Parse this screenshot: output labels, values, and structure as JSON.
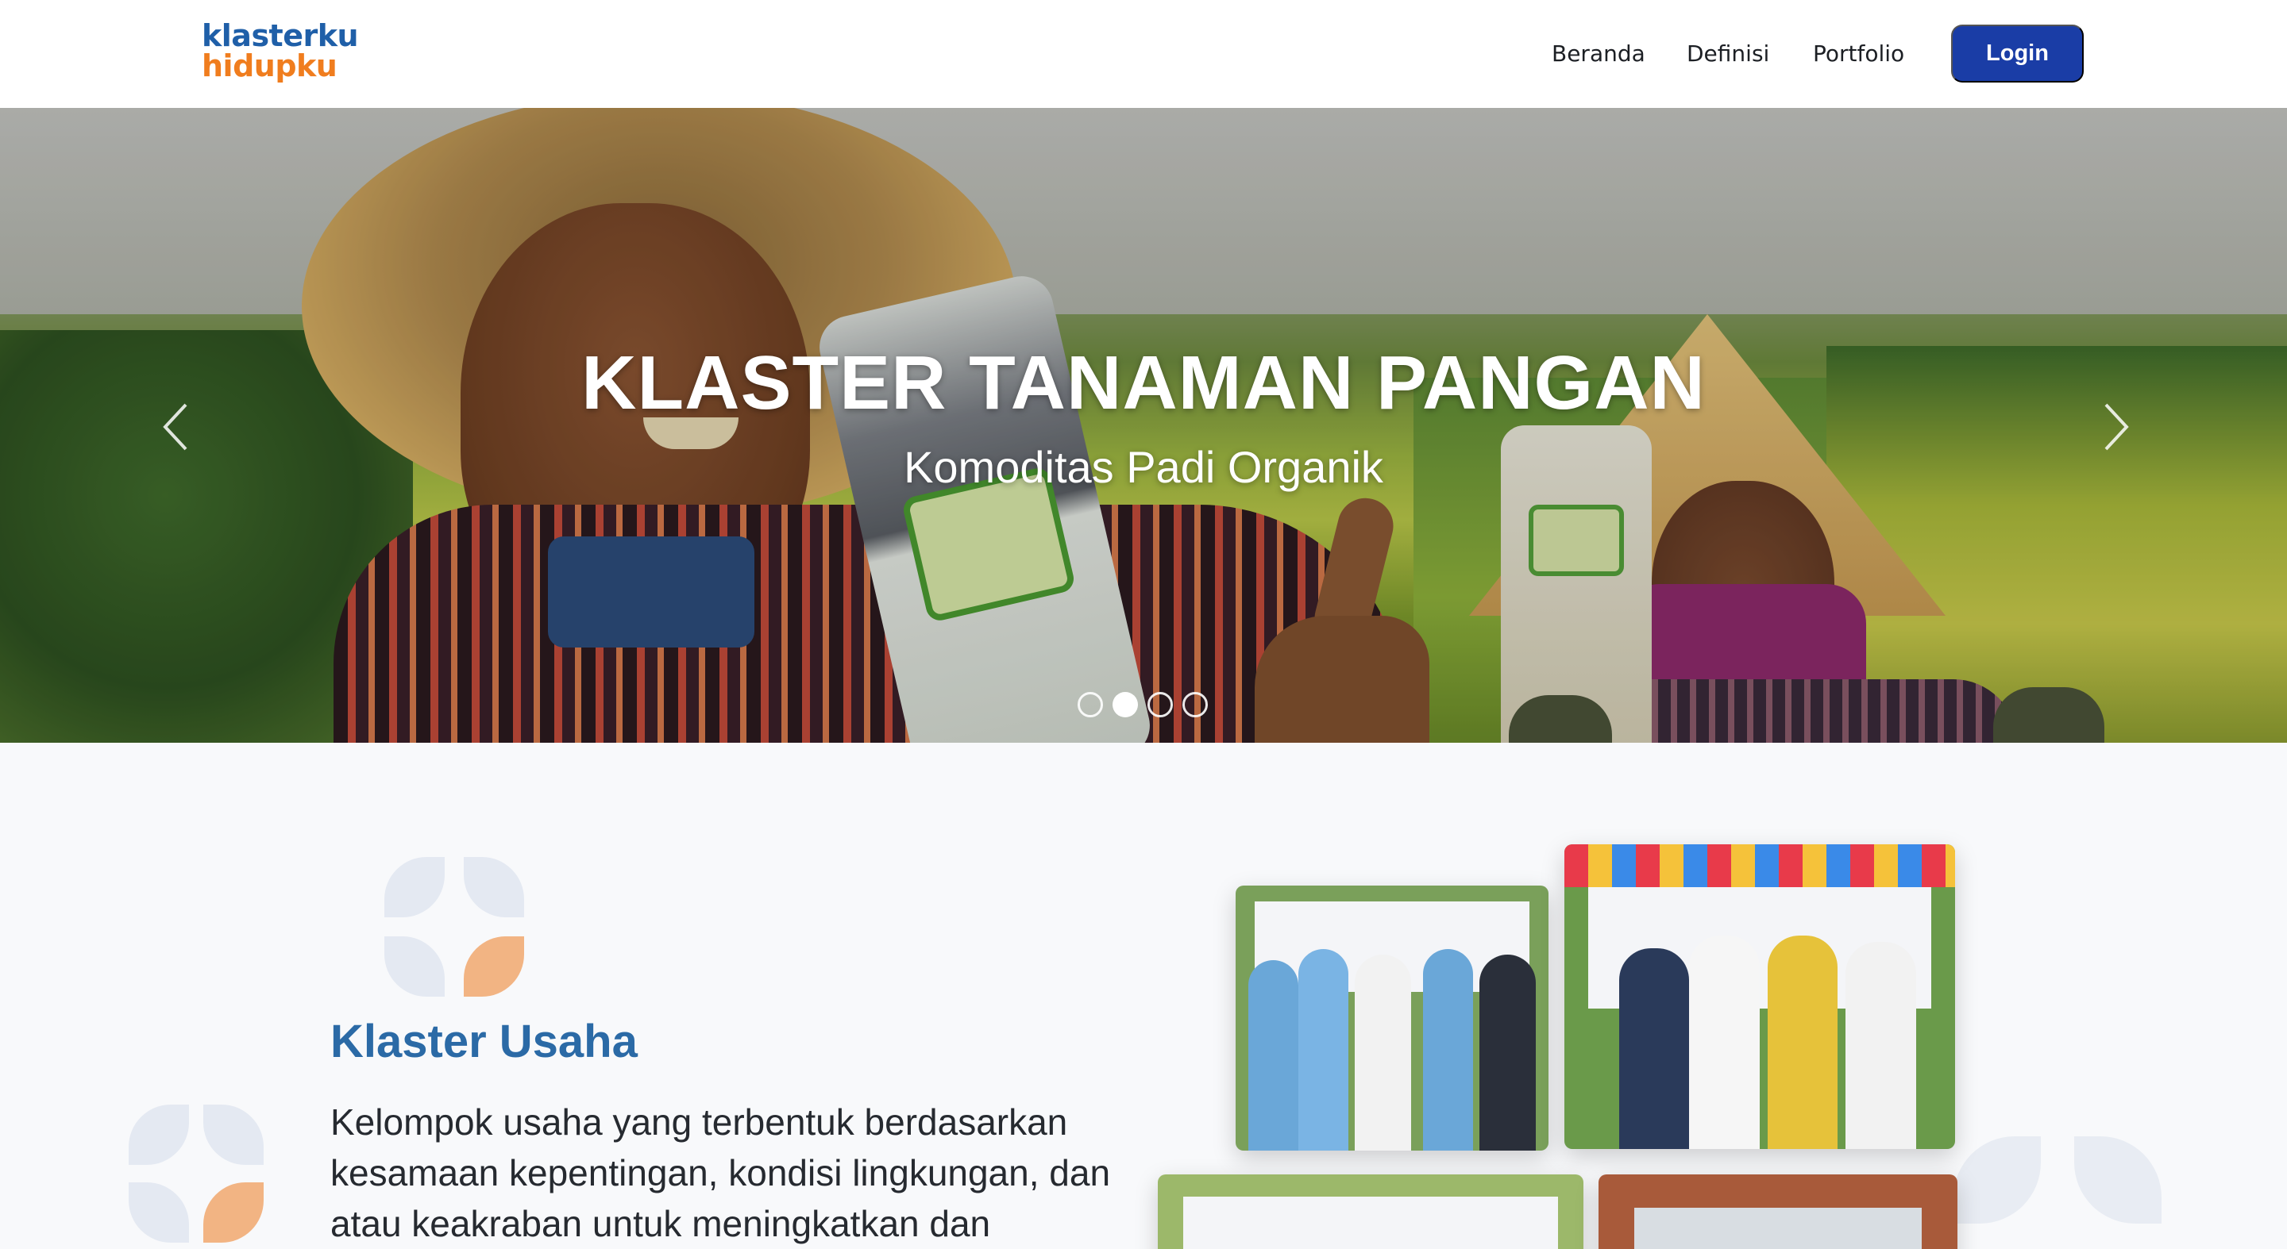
{
  "brand": {
    "line1": "klasterku",
    "line2": "hidupku"
  },
  "nav": {
    "items": [
      {
        "label": "Beranda"
      },
      {
        "label": "Definisi"
      },
      {
        "label": "Portfolio"
      }
    ],
    "login_label": "Login"
  },
  "hero": {
    "title": "KLASTER TANAMAN PANGAN",
    "subtitle": "Komoditas Padi Organik",
    "slide_count": 4,
    "active_slide": 2,
    "prev_icon": "chevron-left-icon",
    "next_icon": "chevron-right-icon"
  },
  "section": {
    "title": "Klaster Usaha",
    "description": "Kelompok usaha yang terbentuk berdasarkan kesamaan kepentingan, kondisi lingkungan, dan atau keakraban untuk meningkatkan dan"
  },
  "colors": {
    "brand_blue": "#1f5fa8",
    "brand_orange": "#f07d1e",
    "login_button": "#1a3da6",
    "section_title": "#2b6aa6",
    "petal_orange": "#f2b483",
    "petal_light": "#e2e8f2"
  }
}
